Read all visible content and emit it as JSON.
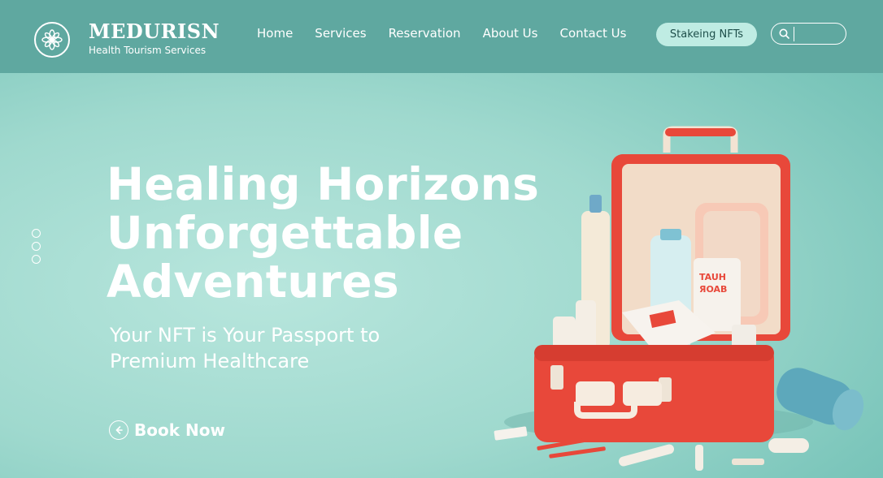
{
  "brand": {
    "name": "MEDURISN",
    "tagline": "Health Tourism Services",
    "logo_icon": "lotus-icon"
  },
  "nav": {
    "items": [
      {
        "label": "Home"
      },
      {
        "label": "Services"
      },
      {
        "label": "Reservation"
      },
      {
        "label": "About Us"
      },
      {
        "label": "Contact Us"
      }
    ],
    "cta_label": "Stakeing NFTs"
  },
  "search": {
    "icon": "search-icon",
    "value": "",
    "placeholder": ""
  },
  "hero": {
    "title_lines": [
      "Healing Horizons",
      "Unforgettable",
      "Adventures"
    ],
    "subtitle_lines": [
      "Your NFT is Your Passport to",
      "Premium Healthcare"
    ],
    "cta_label": "Book Now",
    "cta_icon": "arrow-left-circle-icon",
    "slide_count": 3,
    "image_box_text": [
      "TAUH",
      "ЯOAB"
    ]
  },
  "colors": {
    "header_bg": "#5fa8a0",
    "hero_bg": "#a9dcd3",
    "cta_bg": "#bfece3",
    "kit_red": "#e8483a",
    "text": "#ffffff"
  }
}
